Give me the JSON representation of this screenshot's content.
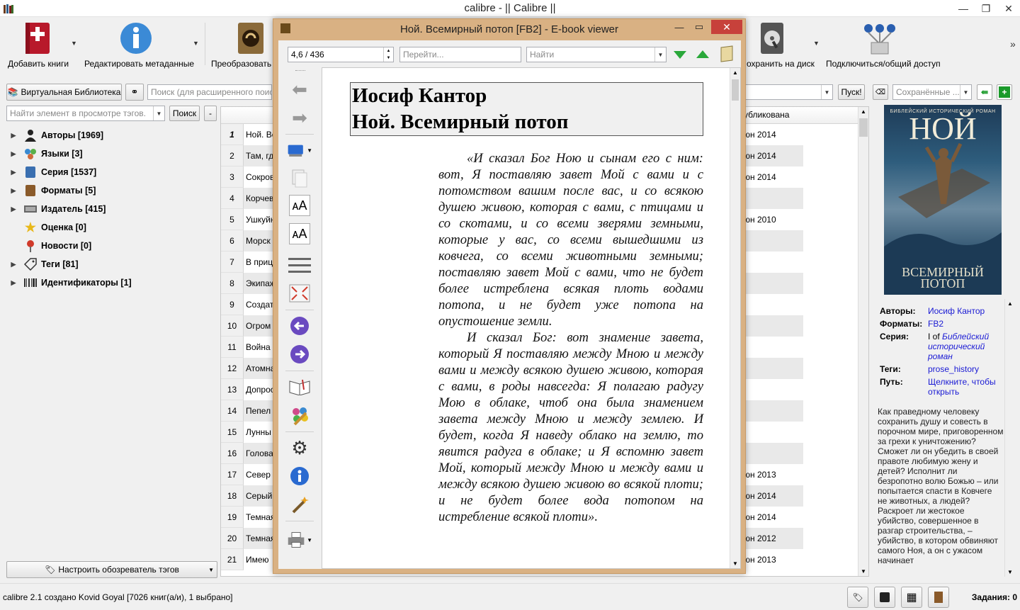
{
  "window": {
    "title": "calibre - || Calibre ||"
  },
  "toolbar": {
    "add_books": "Добавить книги",
    "edit_metadata": "Редактировать метаданные",
    "convert": "Преобразовать к",
    "save_to_disk": "охранить на диск",
    "connect_share": "Подключиться/общий доступ"
  },
  "search": {
    "virtual_library": "Виртуальная Библиотека",
    "placeholder": "Поиск (для расширенного поиска",
    "go": "Пуск!",
    "saved_placeholder": "Сохранённые ..."
  },
  "tagbrowser": {
    "find_placeholder": "Найти элемент в просмотре тэгов.",
    "find_button": "Поиск",
    "collapse_button": "-",
    "items": [
      {
        "label": "Авторы [1969]",
        "icon": "person-icon",
        "expandable": true
      },
      {
        "label": "Языки [3]",
        "icon": "languages-icon",
        "expandable": true
      },
      {
        "label": "Серия [1537]",
        "icon": "series-icon",
        "expandable": true
      },
      {
        "label": "Форматы [5]",
        "icon": "formats-icon",
        "expandable": true
      },
      {
        "label": "Издатель [415]",
        "icon": "publisher-icon",
        "expandable": true
      },
      {
        "label": "Оценка [0]",
        "icon": "star-icon",
        "expandable": false
      },
      {
        "label": "Новости [0]",
        "icon": "news-icon",
        "expandable": false
      },
      {
        "label": "Теги [81]",
        "icon": "tag-icon",
        "expandable": true
      },
      {
        "label": "Идентификаторы [1]",
        "icon": "barcode-icon",
        "expandable": true
      }
    ],
    "configure": "Настроить обозреватель тэгов"
  },
  "booklist": {
    "col_published": "убликована",
    "rows": [
      {
        "n": "1",
        "title": "Ной. Вс",
        "pub": "юн 2014"
      },
      {
        "n": "2",
        "title": "Там, где",
        "pub": "юн 2014"
      },
      {
        "n": "3",
        "title": "Сокров",
        "pub": "юн 2014"
      },
      {
        "n": "4",
        "title": "Корчев",
        "pub": ""
      },
      {
        "n": "5",
        "title": "Ушкуйн",
        "pub": "юн 2010"
      },
      {
        "n": "6",
        "title": "Морск",
        "pub": ""
      },
      {
        "n": "7",
        "title": "В приц",
        "pub": ""
      },
      {
        "n": "8",
        "title": "Экипаж",
        "pub": ""
      },
      {
        "n": "9",
        "title": "Создат",
        "pub": ""
      },
      {
        "n": "10",
        "title": "Огром",
        "pub": ""
      },
      {
        "n": "11",
        "title": "Война",
        "pub": ""
      },
      {
        "n": "12",
        "title": "Атомна",
        "pub": ""
      },
      {
        "n": "13",
        "title": "Допрос",
        "pub": ""
      },
      {
        "n": "14",
        "title": "Пепел",
        "pub": ""
      },
      {
        "n": "15",
        "title": "Лунны",
        "pub": ""
      },
      {
        "n": "16",
        "title": "Голова",
        "pub": ""
      },
      {
        "n": "17",
        "title": "Север",
        "pub": "юн 2013"
      },
      {
        "n": "18",
        "title": "Серый",
        "pub": "юн 2014"
      },
      {
        "n": "19",
        "title": "Темная",
        "pub": "юн 2014"
      },
      {
        "n": "20",
        "title": "Темная",
        "pub": "юн 2012"
      },
      {
        "n": "21",
        "title": "Имею",
        "pub": "юн 2013"
      }
    ]
  },
  "details": {
    "cover_top": "БИБЛЕЙСКИЙ ИСТОРИЧЕСКИЙ РОМАН",
    "cover_title": "НОЙ",
    "cover_sub": "ВСЕМИРНЫЙ ПОТОП",
    "authors_k": "Авторы:",
    "authors_v": "Иосиф Кантор",
    "formats_k": "Форматы:",
    "formats_v": "FB2",
    "series_k": "Серия:",
    "series_prefix": "I of ",
    "series_v": "Библейский исторический роман",
    "tags_k": "Теги:",
    "tags_v": "prose_history",
    "path_k": "Путь:",
    "path_v": "Щелкните, чтобы открыть",
    "description": "Как праведному человеку сохранить душу и совесть в порочном мире, приговоренном за грехи к уничтожению? Сможет ли он убедить в своей правоте любимую жену и детей? Исполнит ли безропотно волю Божью – или попытается спасти в Ковчеге не животных, а людей? Раскроет ли жестокое убийство, совершенное в разгар строительства, – убийство, в котором обвиняют самого Ноя, а он с ужасом начинает"
  },
  "status": {
    "text": "calibre 2.1 создано Kovid Goyal  [7026 книг(а/и), 1 выбрано]",
    "jobs": "Задания: 0"
  },
  "viewer": {
    "title": "Ной. Всемирный потоп [FB2] - E-book viewer",
    "position": "4,6 / 436",
    "goto_placeholder": "Перейти...",
    "find_placeholder": "Найти",
    "heading1": "Иосиф Кантор",
    "heading2": "Ной. Всемирный потоп",
    "para1": "«И сказал Бог Ною и сынам его с ним: вот, Я поставляю завет Мой с вами и с потомством вашим после вас, и со всякою душею живою, которая с вами, с птицами и со скотами, и со всеми зверями земными, которые у вас, со всеми вышедшими из ковчега, со всеми животными земными; поставляю завет Мой с вами, что не будет более истреблена всякая плоть водами потопа, и не будет уже потопа на опустошение земли.",
    "para2": "И сказал Бог: вот знамение завета, который Я поставляю между Мною и между вами и между всякою душею живою, которая с вами, в роды навсегда: Я полагаю радугу Мою в облаке, чтоб она была знамением завета между Мною и между землею. И будет, когда Я наведу облако на землю, то явится радуга в облаке; и Я вспомню завет Мой, который между Мною и между вами и между всякою душею живою во всякой плоти; и не будет более вода потопом на истребление всякой плоти»."
  }
}
